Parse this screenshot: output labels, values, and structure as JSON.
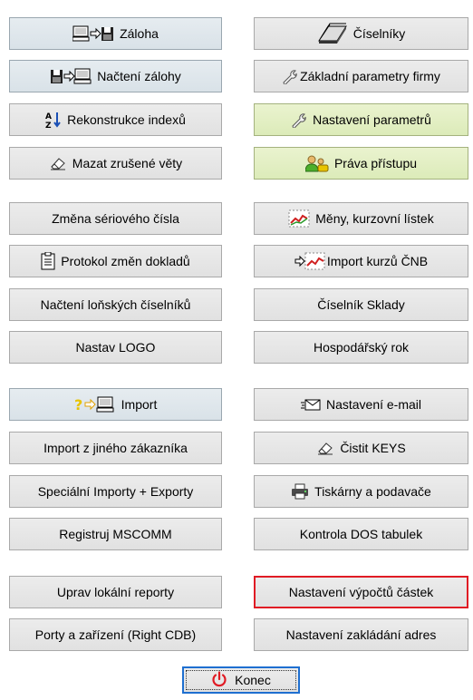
{
  "left": [
    {
      "icon": "backup-to-disk-icon",
      "label": "Záloha"
    },
    {
      "icon": "restore-from-disk-icon",
      "label": "Načtení zálohy"
    },
    {
      "icon": "sort-az-icon",
      "label": "Rekonstrukce indexů"
    },
    {
      "icon": "eraser-icon",
      "label": "Mazat zrušené věty"
    },
    {
      "icon": "",
      "label": "Změna sériového čísla"
    },
    {
      "icon": "document-icon",
      "label": "Protokol změn dokladů"
    },
    {
      "icon": "",
      "label": "Načtení loňských číselníků"
    },
    {
      "icon": "",
      "label": "Nastav LOGO"
    },
    {
      "icon": "import-icon",
      "label": "Import"
    },
    {
      "icon": "",
      "label": "Import z jiného zákazníka"
    },
    {
      "icon": "",
      "label": "Speciální Importy + Exporty"
    },
    {
      "icon": "",
      "label": "Registruj MSCOMM"
    },
    {
      "icon": "",
      "label": "Uprav lokální reporty"
    },
    {
      "icon": "",
      "label": "Porty a zařízení (Right CDB)"
    }
  ],
  "right": [
    {
      "icon": "file-stack-icon",
      "label": "Číselníky"
    },
    {
      "icon": "wrench-icon",
      "label": "Základní parametry firmy"
    },
    {
      "icon": "wrench-icon",
      "label": "Nastavení parametrů"
    },
    {
      "icon": "users-key-icon",
      "label": "Práva přístupu"
    },
    {
      "icon": "chart-line-icon",
      "label": "Měny, kurzovní lístek"
    },
    {
      "icon": "chart-import-icon",
      "label": "Import kurzů ČNB"
    },
    {
      "icon": "",
      "label": "Číselník Sklady"
    },
    {
      "icon": "",
      "label": "Hospodářský rok"
    },
    {
      "icon": "envelope-icon",
      "label": "Nastavení e-mail"
    },
    {
      "icon": "eraser-icon",
      "label": "Čistit KEYS"
    },
    {
      "icon": "printer-icon",
      "label": "Tiskárny a podavače"
    },
    {
      "icon": "",
      "label": "Kontrola DOS tabulek"
    },
    {
      "icon": "",
      "label": "Nastavení výpočtů částek"
    },
    {
      "icon": "",
      "label": "Nastavení zakládání adres"
    }
  ],
  "exit": {
    "icon": "power-icon",
    "label": "Konec"
  },
  "colors": {
    "highlight_border": "#e01b24",
    "focus_border": "#1e6fd0",
    "blue_button": "#dfe6eb",
    "green_button": "#e3efc4"
  }
}
